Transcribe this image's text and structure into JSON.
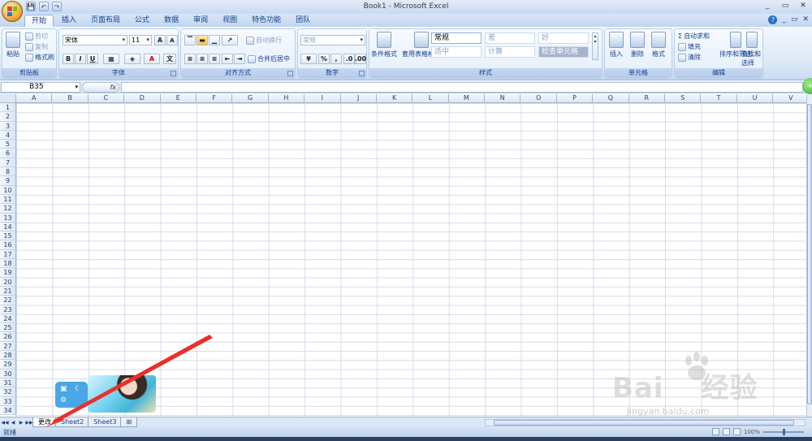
{
  "window": {
    "title": "Book1 - Microsoft Excel",
    "controls": [
      "_",
      "▭",
      "✕"
    ]
  },
  "qat": [
    "💾",
    "↶",
    "↷"
  ],
  "tabs": [
    {
      "label": "开始",
      "active": true
    },
    {
      "label": "插入"
    },
    {
      "label": "页面布局"
    },
    {
      "label": "公式"
    },
    {
      "label": "数据"
    },
    {
      "label": "审阅"
    },
    {
      "label": "视图"
    },
    {
      "label": "特色功能"
    },
    {
      "label": "团队"
    }
  ],
  "ribbon": {
    "clipboard": {
      "label": "剪贴板",
      "paste": "粘贴",
      "cut": "剪切",
      "copy": "复制",
      "format_painter": "格式刷"
    },
    "font": {
      "label": "字体",
      "font_name": "宋体",
      "font_size": "11",
      "bold": "B",
      "italic": "I",
      "underline": "U",
      "grow": "A",
      "shrink": "A"
    },
    "alignment": {
      "label": "对齐方式",
      "wrap": "自动换行",
      "merge": "合并后居中"
    },
    "number": {
      "label": "数字",
      "format": "常规",
      "percent": "%",
      "comma": ","
    },
    "styles": {
      "label": "样式",
      "cond_format": "条件格式",
      "table_format": "套用表格格式",
      "normal": "常规",
      "bad": "差",
      "good": "好",
      "neutral": "适中",
      "calc": "计算",
      "check": "检查单元格"
    },
    "cells": {
      "label": "单元格",
      "insert": "插入",
      "delete": "删除",
      "format": "格式"
    },
    "editing": {
      "label": "编辑",
      "autosum": "自动求和",
      "fill": "填充",
      "clear": "清除",
      "sort": "排序和筛选",
      "find": "查找和选择"
    }
  },
  "formula_bar": {
    "name_box": "B35",
    "fx": "fx"
  },
  "columns": [
    "A",
    "B",
    "C",
    "D",
    "E",
    "F",
    "G",
    "H",
    "I",
    "J",
    "K",
    "L",
    "M",
    "N",
    "O",
    "P",
    "Q",
    "R",
    "S",
    "T",
    "U",
    "V"
  ],
  "rows": [
    "1",
    "2",
    "3",
    "4",
    "5",
    "6",
    "7",
    "8",
    "9",
    "10",
    "11",
    "12",
    "13",
    "14",
    "15",
    "16",
    "17",
    "18",
    "19",
    "20",
    "21",
    "22",
    "23",
    "24",
    "25",
    "26",
    "27",
    "28",
    "29",
    "30",
    "31",
    "32",
    "33",
    "34"
  ],
  "sheets": [
    {
      "label": "更改",
      "active": true
    },
    {
      "label": "Sheet2"
    },
    {
      "label": "Sheet3"
    }
  ],
  "status": {
    "ready": "就绪",
    "zoom": "100%"
  },
  "watermark": {
    "brand": "Bai",
    "brand2": "经验",
    "url": "jingyan.baidu.com"
  },
  "colors": {
    "accent": "#15428b",
    "arrow": "#e8302b",
    "widget": "#49a7e8"
  }
}
